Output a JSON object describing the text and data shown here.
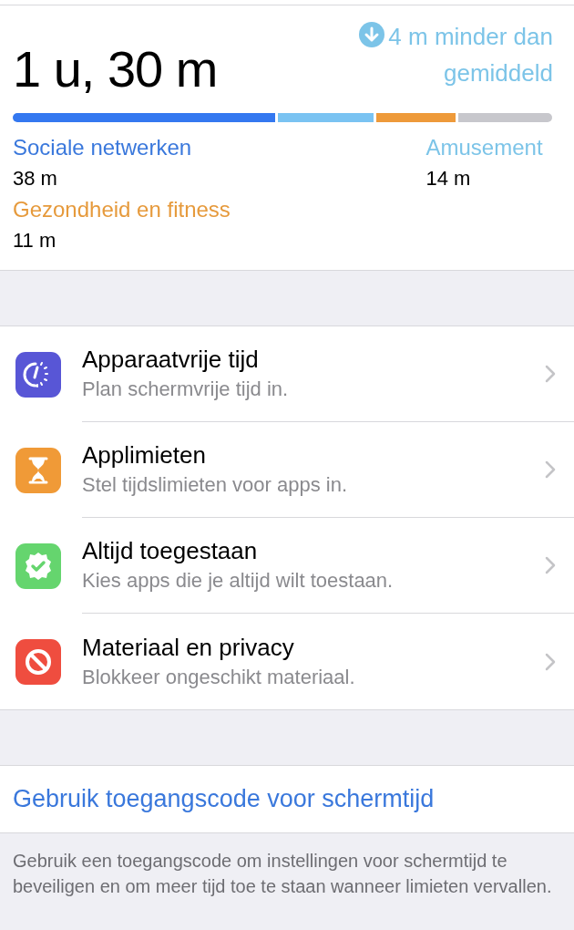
{
  "summary": {
    "total": "1 u, 30 m",
    "comparison": "4 m minder dan gemiddeld"
  },
  "usage_bar": [
    {
      "color": "#3478f0"
    },
    {
      "color": "#7ac3f2"
    },
    {
      "color": "#ee9a3a"
    },
    {
      "color": "#c7c7cc"
    }
  ],
  "categories": [
    {
      "name": "Sociale netwerken",
      "time": "38 m",
      "color": "#3a78dc"
    },
    {
      "name": "Amusement",
      "time": "14 m",
      "color": "#7cc4e8"
    },
    {
      "name": "Gezondheid en fitness",
      "time": "11 m",
      "color": "#e69a3c"
    }
  ],
  "settings": [
    {
      "kind": "downtime",
      "title": "Apparaatvrije tijd",
      "subtitle": "Plan schermvrije tijd in."
    },
    {
      "kind": "limits",
      "title": "Applimieten",
      "subtitle": "Stel tijdslimieten voor apps in."
    },
    {
      "kind": "allowed",
      "title": "Altijd toegestaan",
      "subtitle": "Kies apps die je altijd wilt toestaan."
    },
    {
      "kind": "restrictions",
      "title": "Materiaal en privacy",
      "subtitle": "Blokkeer ongeschikt materiaal."
    }
  ],
  "passcode_link": "Gebruik toegangscode voor schermtijd",
  "footer": "Gebruik een toegangscode om instellingen voor schermtijd te beveiligen en om meer tijd toe te staan wanneer limieten vervallen."
}
